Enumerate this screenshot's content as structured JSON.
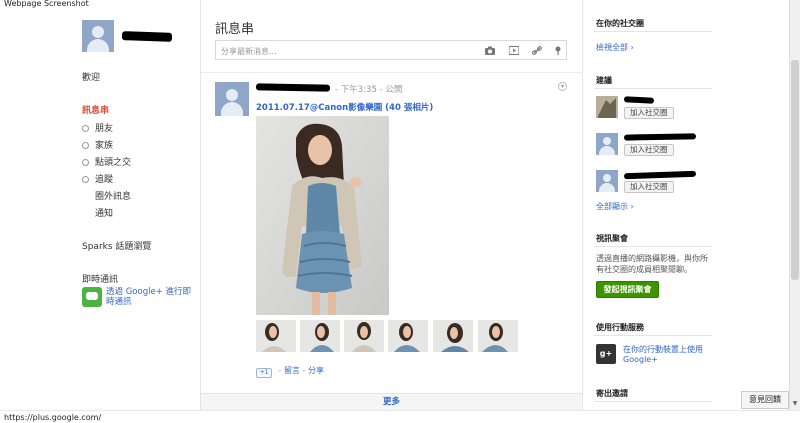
{
  "window": {
    "title": "Webpage Screenshot"
  },
  "left_nav": {
    "welcome": "歡迎",
    "stream": "訊息串",
    "circles": [
      "朋友",
      "家族",
      "點頭之交",
      "追蹤"
    ],
    "incoming": "圈外訊息",
    "notifications": "通知",
    "sparks": "Sparks 話題瀏覽",
    "chat_heading": "即時通訊",
    "chat_link": "透過 Google+ 進行即時通訊"
  },
  "stream": {
    "title": "訊息串",
    "share_placeholder": "分享最新消息...",
    "share_icons": [
      "camera-icon",
      "video-icon",
      "link-icon",
      "location-icon"
    ]
  },
  "post": {
    "time": "下午3:35",
    "visibility": "公開",
    "album_title": "2011.07.17@Canon影像樂園 (40 張相片)",
    "plus_one": "+1",
    "comment": "留言",
    "share": "分享",
    "separator": "-"
  },
  "more": "更多",
  "right": {
    "in_circles_heading": "在你的社交圈",
    "view_all": "檢視全部 ›",
    "suggestions_heading": "建議",
    "add_circle_label": "加入社交圈",
    "show_all": "全部顯示 ›",
    "hangout_heading": "視訊聚會",
    "hangout_desc": "透過直播的網路攝影機，與你所有社交圈的成員相聚閒聊。",
    "hangout_button": "發起視訊聚會",
    "mobile_heading": "使用行動服務",
    "mobile_link": "在你的行動裝置上使用 Google+",
    "invite_heading": "寄出邀請",
    "gplus_glyph": "g+"
  },
  "feedback": "意見回饋",
  "status_url": "https://plus.google.com/",
  "colors": {
    "accent_red": "#dd4b39",
    "link_blue": "#3366cc",
    "hangout_green": "#3d9400"
  }
}
